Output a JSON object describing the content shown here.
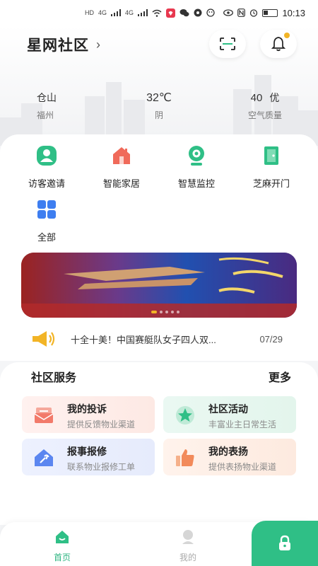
{
  "status_bar": {
    "time": "10:13",
    "signal_label": "HD",
    "network_labels": [
      "4G",
      "4G"
    ]
  },
  "header": {
    "community_name": "星网社区",
    "chevron_icon": "chevron-right-icon",
    "scan_icon": "scan-icon",
    "bell_icon": "bell-icon",
    "notification_dot_color": "#f2b426"
  },
  "weather": {
    "district": "仓山",
    "city": "福州",
    "temperature": "32℃",
    "condition": "阴",
    "aqi_value": "40",
    "aqi_level": "优",
    "aqi_label": "空气质量"
  },
  "quick_actions": [
    {
      "label": "访客邀请",
      "icon": "visitor-icon",
      "color": "#2fbf86"
    },
    {
      "label": "智能家居",
      "icon": "smart-home-icon",
      "color": "#f06a5a"
    },
    {
      "label": "智慧监控",
      "icon": "camera-icon",
      "color": "#2fbf86"
    },
    {
      "label": "芝麻开门",
      "icon": "door-icon",
      "color": "#2fbf86"
    },
    {
      "label": "全部",
      "icon": "grid-icon",
      "color": "#3e7ef0"
    }
  ],
  "banner": {
    "active_index": 0,
    "slide_count": 5
  },
  "news": {
    "icon": "megaphone-icon",
    "text": "十全十美！中国赛艇队女子四人双...",
    "date": "07/29"
  },
  "community_services": {
    "title": "社区服务",
    "more": "更多",
    "cards": [
      {
        "title": "我的投诉",
        "subtitle": "提供反馈物业渠道",
        "icon": "complaint-icon",
        "color": "#f27a6a"
      },
      {
        "title": "社区活动",
        "subtitle": "丰富业主日常生活",
        "icon": "star-icon",
        "color": "#2fbf86"
      },
      {
        "title": "报事报修",
        "subtitle": "联系物业报修工单",
        "icon": "repair-icon",
        "color": "#5b86f0"
      },
      {
        "title": "我的表扬",
        "subtitle": "提供表扬物业渠道",
        "icon": "thumbs-up-icon",
        "color": "#f28a5a"
      }
    ]
  },
  "tab_bar": {
    "home_label": "首页",
    "mine_label": "我的",
    "active_color": "#2fb582",
    "unlock_icon": "lock-icon",
    "unlock_color": "#2fbf86"
  }
}
